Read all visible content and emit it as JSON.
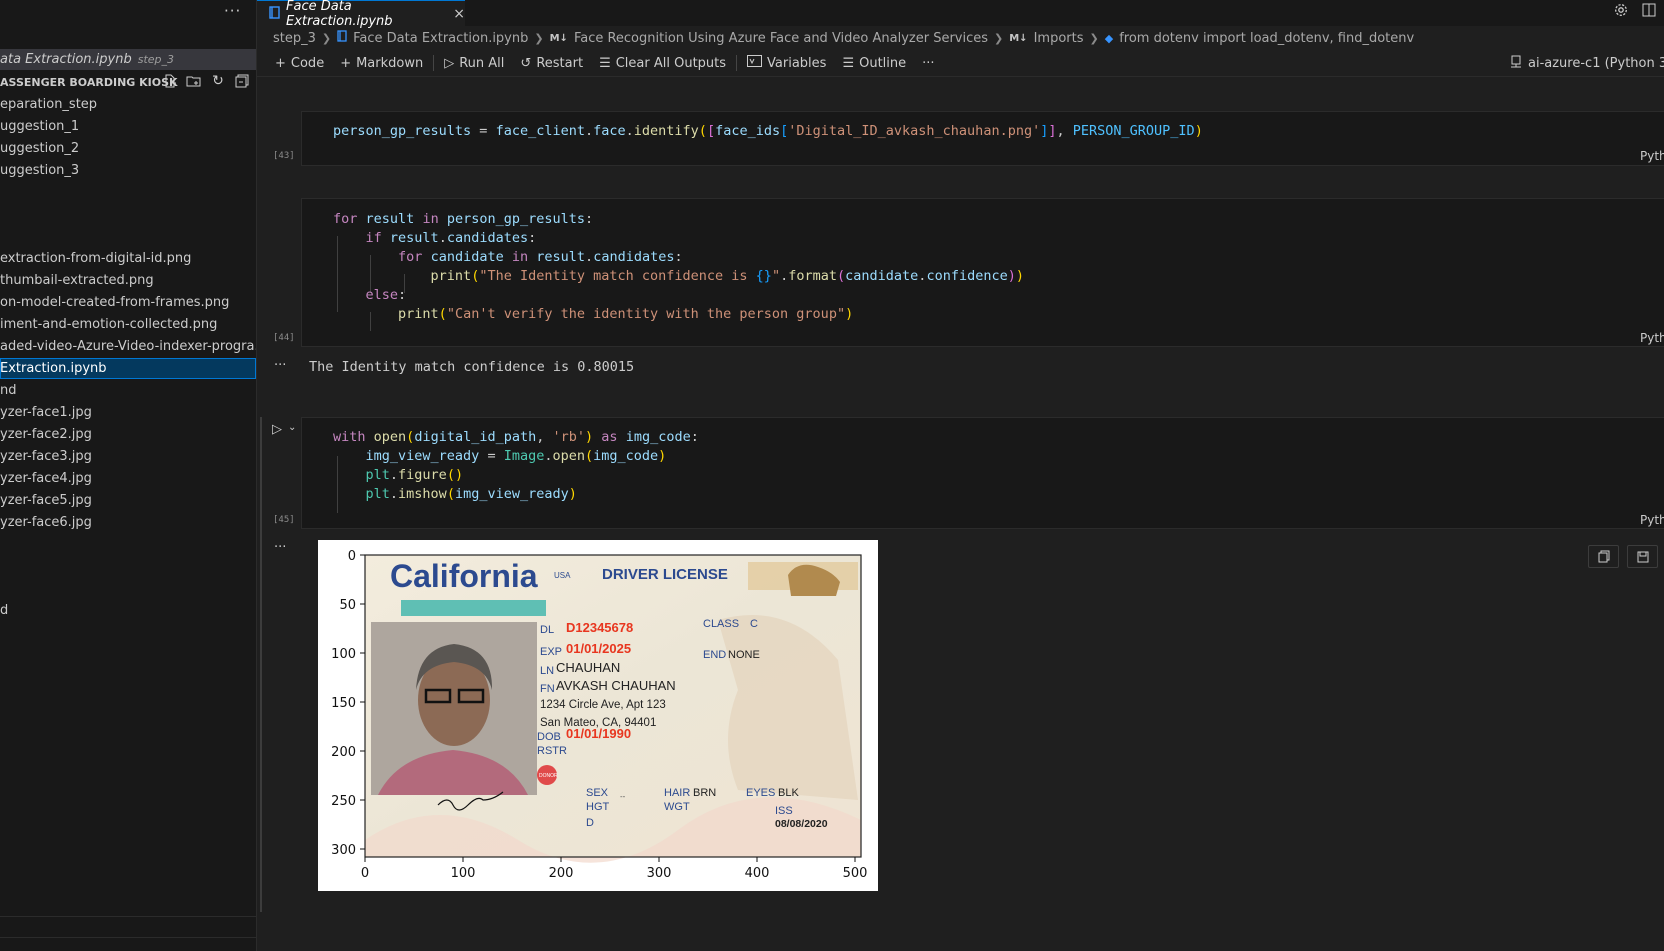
{
  "sidebar": {
    "more_label": "···",
    "open_editor": {
      "name": "ata Extraction.ipynb",
      "desc": "step_3"
    },
    "section_title": "ASSENGER BOARDING KIOSK",
    "items": [
      "eparation_step",
      "uggestion_1",
      "uggestion_2",
      "uggestion_3",
      "extraction-from-digital-id.png",
      "thumbail-extracted.png",
      "on-model-created-from-frames.png",
      "iment-and-emotion-collected.png",
      "aded-video-Azure-Video-indexer-progra...",
      "Extraction.ipynb",
      "nd",
      "yzer-face1.jpg",
      "yzer-face2.jpg",
      "yzer-face3.jpg",
      "yzer-face4.jpg",
      "yzer-face5.jpg",
      "yzer-face6.jpg",
      "d"
    ]
  },
  "tab": {
    "title": "Face Data Extraction.ipynb",
    "close": "×"
  },
  "breadcrumb": {
    "folder": "step_3",
    "file": "Face Data Extraction.ipynb",
    "md_marker": "M↓",
    "section1": "Face Recognition Using Azure Face and Video Analyzer Services",
    "section2": "Imports",
    "symbol": "from dotenv import load_dotenv, find_dotenv"
  },
  "toolbar": {
    "code": "Code",
    "markdown": "Markdown",
    "run_all": "Run All",
    "restart": "Restart",
    "clear_outputs": "Clear All Outputs",
    "variables": "Variables",
    "outline": "Outline",
    "more": "···"
  },
  "kernel": {
    "label": "ai-azure-c1 (Python 3.8"
  },
  "cells": {
    "c43": {
      "count": "[43]",
      "lang": "Pyth"
    },
    "c44": {
      "count": "[44]",
      "lang": "Pyth",
      "output": "The Identity match confidence is 0.80015"
    },
    "c45": {
      "count": "[45]",
      "lang": "Pyth"
    }
  },
  "plot": {
    "yticks": [
      "0",
      "50",
      "100",
      "150",
      "200",
      "250",
      "300"
    ],
    "xticks": [
      "0",
      "100",
      "200",
      "300",
      "400",
      "500"
    ]
  },
  "license": {
    "state": "California",
    "usa": "USA",
    "title": "DRIVER LICENSE",
    "dl_label": "DL",
    "dl": "D12345678",
    "exp_label": "EXP",
    "exp": "01/01/2025",
    "class_label": "CLASS",
    "class": "C",
    "end_label": "END",
    "end": "NONE",
    "ln_label": "LN",
    "ln": "CHAUHAN",
    "fn_label": "FN",
    "fn": "AVKASH CHAUHAN",
    "addr1": "1234 Circle Ave, Apt 123",
    "addr2": "San Mateo, CA, 94401",
    "dob_label": "DOB",
    "dob": "01/01/1990",
    "rstr_label": "RSTR",
    "donor": "DONOR",
    "sex_label": "SEX",
    "hgt_label": "HGT",
    "d_label": "D",
    "sex_value": "--",
    "hair_label": "HAIR",
    "hair": "BRN",
    "wgt_label": "WGT",
    "eyes_label": "EYES",
    "eyes": "BLK",
    "iss_label": "ISS",
    "iss": "08/08/2020"
  },
  "colors": {
    "accent": "#0078d4",
    "selection": "#04395e",
    "license_red": "#e8361f",
    "license_blue": "#2c4a8f"
  }
}
